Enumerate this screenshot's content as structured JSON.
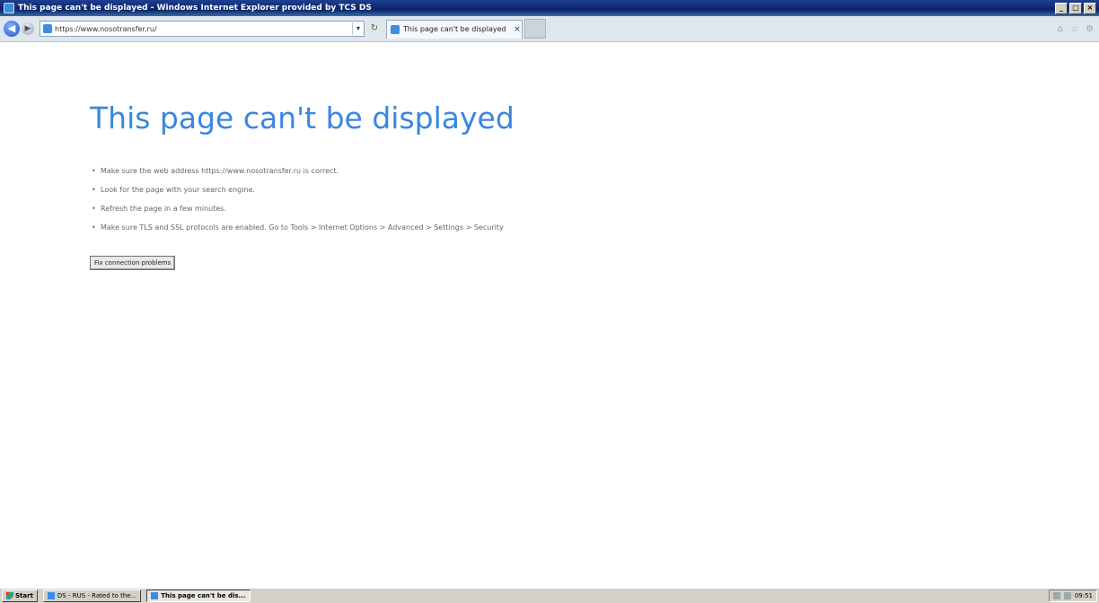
{
  "window": {
    "title": "This page can't be displayed - Windows Internet Explorer provided by TCS DS",
    "controls": {
      "minimize": "_",
      "maximize": "□",
      "close": "×"
    }
  },
  "navbar": {
    "address": "https://www.nosotransfer.ru/",
    "tab_label": "This page can't be displayed",
    "tab_close": "×",
    "refresh": "↻",
    "back": "◀",
    "forward": "▶",
    "dropdown": "▾"
  },
  "content": {
    "heading": "This page can't be displayed",
    "bullets": [
      "Make sure the web address https://www.nosotransfer.ru is correct.",
      "Look for the page with your search engine.",
      "Refresh the page in a few minutes.",
      "Make sure TLS and SSL protocols are enabled. Go to Tools > Internet Options > Advanced > Settings > Security"
    ],
    "fix_button": "Fix connection problems"
  },
  "taskbar": {
    "start": "Start",
    "tasks": [
      "DS - RUS - Rated to the...",
      "This page can't be dis..."
    ],
    "clock": "09:51"
  },
  "icons": {
    "home": "⌂",
    "favorites": "☆",
    "tools": "⚙"
  }
}
